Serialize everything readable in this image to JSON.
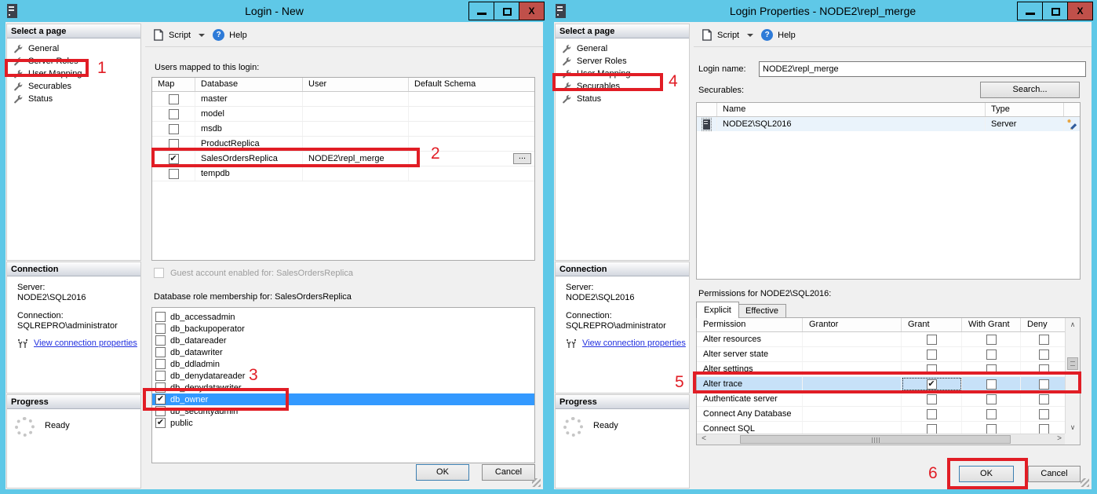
{
  "shared": {
    "select_page_header": "Select a page",
    "pages": [
      "General",
      "Server Roles",
      "User Mapping",
      "Securables",
      "Status"
    ],
    "toolbar": {
      "script": "Script",
      "help": "Help"
    },
    "connection": {
      "header": "Connection",
      "server_label": "Server:",
      "server_value": "NODE2\\SQL2016",
      "connection_label": "Connection:",
      "connection_value": "SQLREPRO\\administrator",
      "link": "View connection properties"
    },
    "progress": {
      "header": "Progress",
      "status": "Ready"
    },
    "buttons": {
      "ok": "OK",
      "cancel": "Cancel"
    }
  },
  "left_window": {
    "title": "Login - New",
    "users_mapped_label": "Users mapped to this login:",
    "map_table": {
      "columns": [
        "Map",
        "Database",
        "User",
        "Default Schema"
      ],
      "rows": [
        {
          "map": false,
          "database": "master",
          "user": "",
          "default_schema": ""
        },
        {
          "map": false,
          "database": "model",
          "user": "",
          "default_schema": ""
        },
        {
          "map": false,
          "database": "msdb",
          "user": "",
          "default_schema": ""
        },
        {
          "map": false,
          "database": "ProductReplica",
          "user": "",
          "default_schema": ""
        },
        {
          "map": true,
          "database": "SalesOrdersReplica",
          "user": "NODE2\\repl_merge",
          "default_schema": "",
          "browse": true
        },
        {
          "map": false,
          "database": "tempdb",
          "user": "",
          "default_schema": ""
        }
      ]
    },
    "guest_checkbox_label": "Guest account enabled for: SalesOrdersReplica",
    "role_membership_label": "Database role membership for: SalesOrdersReplica",
    "roles": [
      {
        "name": "db_accessadmin",
        "checked": false
      },
      {
        "name": "db_backupoperator",
        "checked": false
      },
      {
        "name": "db_datareader",
        "checked": false
      },
      {
        "name": "db_datawriter",
        "checked": false
      },
      {
        "name": "db_ddladmin",
        "checked": false
      },
      {
        "name": "db_denydatareader",
        "checked": false
      },
      {
        "name": "db_denydatawriter",
        "checked": false
      },
      {
        "name": "db_owner",
        "checked": true,
        "selected": true
      },
      {
        "name": "db_securityadmin",
        "checked": false
      },
      {
        "name": "public",
        "checked": true
      }
    ]
  },
  "right_window": {
    "title": "Login Properties - NODE2\\repl_merge",
    "login_name_label": "Login name:",
    "login_name_value": "NODE2\\repl_merge",
    "securables_label": "Securables:",
    "search_button": "Search...",
    "securables_table": {
      "columns": [
        "Name",
        "Type"
      ],
      "rows": [
        {
          "name": "NODE2\\SQL2016",
          "type": "Server"
        }
      ]
    },
    "permissions_label": "Permissions for NODE2\\SQL2016:",
    "tabs": [
      {
        "label": "Explicit",
        "active": true
      },
      {
        "label": "Effective",
        "active": false
      }
    ],
    "permissions_table": {
      "columns": [
        "Permission",
        "Grantor",
        "Grant",
        "With Grant",
        "Deny"
      ],
      "rows": [
        {
          "permission": "Alter resources",
          "grant": false,
          "with_grant": false,
          "deny": false
        },
        {
          "permission": "Alter server state",
          "grant": false,
          "with_grant": false,
          "deny": false
        },
        {
          "permission": "Alter settings",
          "grant": false,
          "with_grant": false,
          "deny": false
        },
        {
          "permission": "Alter trace",
          "grant": true,
          "with_grant": false,
          "deny": false,
          "selected": true
        },
        {
          "permission": "Authenticate server",
          "grant": false,
          "with_grant": false,
          "deny": false
        },
        {
          "permission": "Connect Any Database",
          "grant": false,
          "with_grant": false,
          "deny": false
        },
        {
          "permission": "Connect SQL",
          "grant": false,
          "with_grant": false,
          "deny": false
        }
      ]
    }
  },
  "annotations": [
    "1",
    "2",
    "3",
    "4",
    "5",
    "6"
  ]
}
